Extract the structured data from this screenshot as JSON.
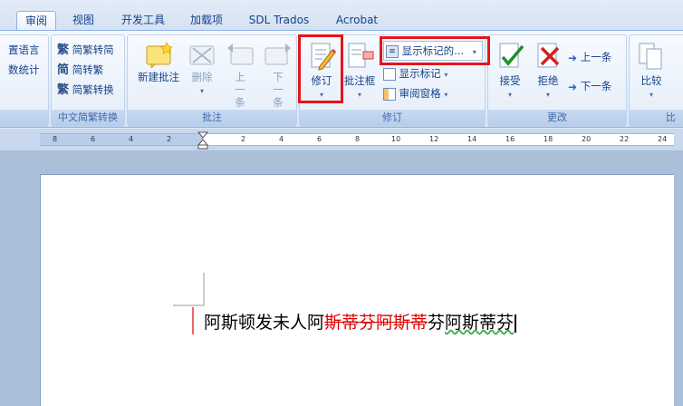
{
  "tabs": [
    {
      "label": "审阅",
      "active": true
    },
    {
      "label": "视图"
    },
    {
      "label": "开发工具"
    },
    {
      "label": "加载项"
    },
    {
      "label": "SDL Trados"
    },
    {
      "label": "Acrobat"
    }
  ],
  "ribbon": {
    "lang_group": {
      "items": [
        "置语言",
        "数统计"
      ]
    },
    "convert_group": {
      "label": "中文简繁转换",
      "items": [
        "简繁转简",
        "简转繁",
        "简繁转换"
      ]
    },
    "comments_group": {
      "label": "批注",
      "new_comment": "新建批注",
      "delete": "删除",
      "previous": "上一条",
      "next": "下一条"
    },
    "track_group": {
      "label": "修订",
      "track_changes": "修订",
      "balloons": "批注框",
      "display_for_review": "显示标记的...",
      "show_markup": "显示标记",
      "reviewing_pane": "审阅窗格"
    },
    "changes_group": {
      "label": "更改",
      "accept": "接受",
      "reject": "拒绝",
      "previous": "上一条",
      "next": "下一条"
    },
    "compare_group": {
      "label": "比",
      "compare": "比较"
    }
  },
  "ruler": {
    "numbers": [
      "8",
      "6",
      "4",
      "2",
      "2",
      "4",
      "6",
      "8",
      "10",
      "12",
      "14",
      "16",
      "18",
      "20",
      "22",
      "24"
    ]
  },
  "document": {
    "text_before": "阿斯顿发未人阿",
    "deleted_text": "斯蒂芬阿斯蒂",
    "text_after_a": "芬",
    "text_after_b": "阿斯蒂芬"
  },
  "colors": {
    "highlight_box": "#e2161b",
    "deleted": "#e00000",
    "accent": "#15428b"
  }
}
